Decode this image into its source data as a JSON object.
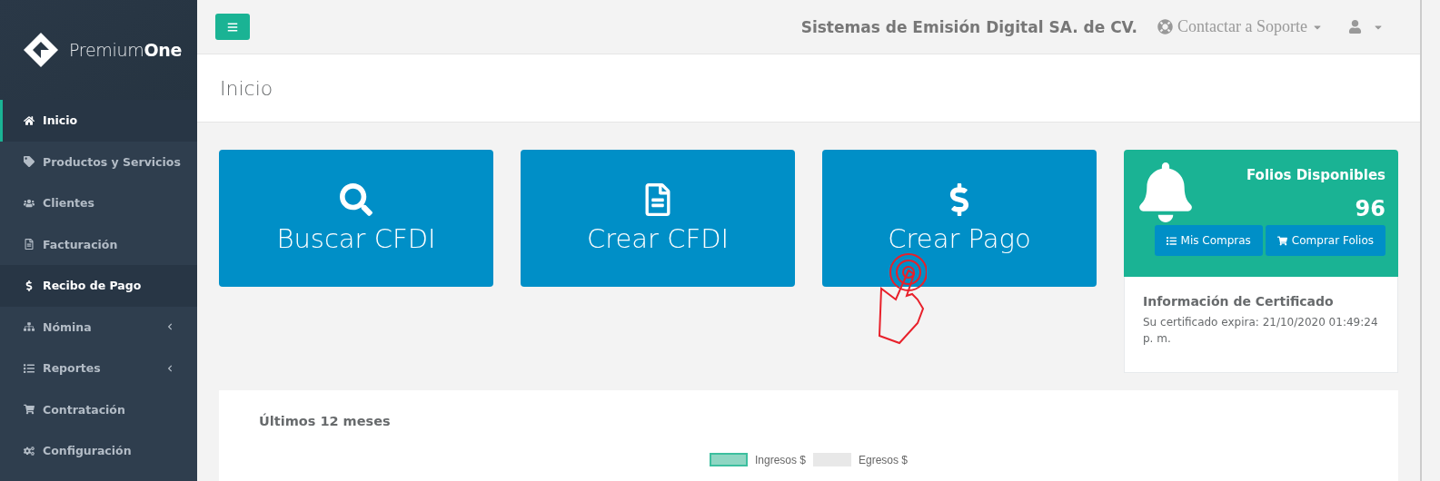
{
  "brand": {
    "light": "Premium",
    "bold": "One"
  },
  "sidebar": {
    "items": [
      {
        "label": "Inicio",
        "selected": true,
        "highlighted": true,
        "expandable": false
      },
      {
        "label": "Productos y Servicios",
        "selected": false,
        "highlighted": false,
        "expandable": false
      },
      {
        "label": "Clientes",
        "selected": false,
        "highlighted": false,
        "expandable": false
      },
      {
        "label": "Facturación",
        "selected": false,
        "highlighted": false,
        "expandable": false
      },
      {
        "label": "Recibo de Pago",
        "selected": false,
        "highlighted": true,
        "expandable": false
      },
      {
        "label": "Nómina",
        "selected": false,
        "highlighted": false,
        "expandable": true
      },
      {
        "label": "Reportes",
        "selected": false,
        "highlighted": false,
        "expandable": true
      },
      {
        "label": "Contratación",
        "selected": false,
        "highlighted": false,
        "expandable": false
      },
      {
        "label": "Configuración",
        "selected": false,
        "highlighted": false,
        "expandable": false
      }
    ]
  },
  "header": {
    "company": "Sistemas de Emisión Digital SA. de CV.",
    "support": "Contactar a Soporte"
  },
  "page_title": "Inicio",
  "tiles": [
    {
      "label": "Buscar CFDI"
    },
    {
      "label": "Crear CFDI"
    },
    {
      "label": "Crear Pago"
    }
  ],
  "folios": {
    "title": "Folios Disponibles",
    "count": "96",
    "buttons": [
      "Mis Compras",
      "Comprar Folios"
    ]
  },
  "certificate": {
    "title": "Información de Certificado",
    "text": "Su certificado expira: 21/10/2020 01:49:24 p. m."
  },
  "chart_card": {
    "title": "Últimos 12 meses",
    "legend": [
      {
        "label": "Ingresos $",
        "color": "#8fd6c3"
      },
      {
        "label": "Egresos $",
        "color": "#e8e8e8"
      }
    ]
  }
}
